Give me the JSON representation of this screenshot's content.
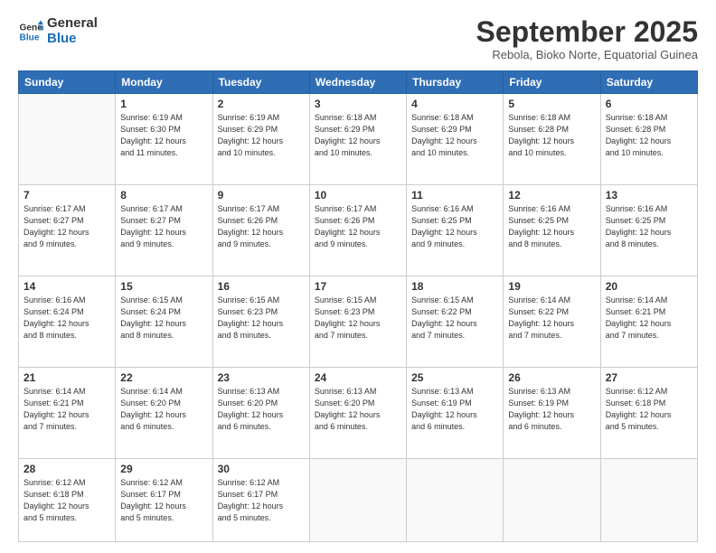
{
  "logo": {
    "line1": "General",
    "line2": "Blue"
  },
  "title": "September 2025",
  "location": "Rebola, Bioko Norte, Equatorial Guinea",
  "header_days": [
    "Sunday",
    "Monday",
    "Tuesday",
    "Wednesday",
    "Thursday",
    "Friday",
    "Saturday"
  ],
  "weeks": [
    [
      {
        "day": "",
        "info": ""
      },
      {
        "day": "1",
        "info": "Sunrise: 6:19 AM\nSunset: 6:30 PM\nDaylight: 12 hours\nand 11 minutes."
      },
      {
        "day": "2",
        "info": "Sunrise: 6:19 AM\nSunset: 6:29 PM\nDaylight: 12 hours\nand 10 minutes."
      },
      {
        "day": "3",
        "info": "Sunrise: 6:18 AM\nSunset: 6:29 PM\nDaylight: 12 hours\nand 10 minutes."
      },
      {
        "day": "4",
        "info": "Sunrise: 6:18 AM\nSunset: 6:29 PM\nDaylight: 12 hours\nand 10 minutes."
      },
      {
        "day": "5",
        "info": "Sunrise: 6:18 AM\nSunset: 6:28 PM\nDaylight: 12 hours\nand 10 minutes."
      },
      {
        "day": "6",
        "info": "Sunrise: 6:18 AM\nSunset: 6:28 PM\nDaylight: 12 hours\nand 10 minutes."
      }
    ],
    [
      {
        "day": "7",
        "info": "Sunrise: 6:17 AM\nSunset: 6:27 PM\nDaylight: 12 hours\nand 9 minutes."
      },
      {
        "day": "8",
        "info": "Sunrise: 6:17 AM\nSunset: 6:27 PM\nDaylight: 12 hours\nand 9 minutes."
      },
      {
        "day": "9",
        "info": "Sunrise: 6:17 AM\nSunset: 6:26 PM\nDaylight: 12 hours\nand 9 minutes."
      },
      {
        "day": "10",
        "info": "Sunrise: 6:17 AM\nSunset: 6:26 PM\nDaylight: 12 hours\nand 9 minutes."
      },
      {
        "day": "11",
        "info": "Sunrise: 6:16 AM\nSunset: 6:25 PM\nDaylight: 12 hours\nand 9 minutes."
      },
      {
        "day": "12",
        "info": "Sunrise: 6:16 AM\nSunset: 6:25 PM\nDaylight: 12 hours\nand 8 minutes."
      },
      {
        "day": "13",
        "info": "Sunrise: 6:16 AM\nSunset: 6:25 PM\nDaylight: 12 hours\nand 8 minutes."
      }
    ],
    [
      {
        "day": "14",
        "info": "Sunrise: 6:16 AM\nSunset: 6:24 PM\nDaylight: 12 hours\nand 8 minutes."
      },
      {
        "day": "15",
        "info": "Sunrise: 6:15 AM\nSunset: 6:24 PM\nDaylight: 12 hours\nand 8 minutes."
      },
      {
        "day": "16",
        "info": "Sunrise: 6:15 AM\nSunset: 6:23 PM\nDaylight: 12 hours\nand 8 minutes."
      },
      {
        "day": "17",
        "info": "Sunrise: 6:15 AM\nSunset: 6:23 PM\nDaylight: 12 hours\nand 7 minutes."
      },
      {
        "day": "18",
        "info": "Sunrise: 6:15 AM\nSunset: 6:22 PM\nDaylight: 12 hours\nand 7 minutes."
      },
      {
        "day": "19",
        "info": "Sunrise: 6:14 AM\nSunset: 6:22 PM\nDaylight: 12 hours\nand 7 minutes."
      },
      {
        "day": "20",
        "info": "Sunrise: 6:14 AM\nSunset: 6:21 PM\nDaylight: 12 hours\nand 7 minutes."
      }
    ],
    [
      {
        "day": "21",
        "info": "Sunrise: 6:14 AM\nSunset: 6:21 PM\nDaylight: 12 hours\nand 7 minutes."
      },
      {
        "day": "22",
        "info": "Sunrise: 6:14 AM\nSunset: 6:20 PM\nDaylight: 12 hours\nand 6 minutes."
      },
      {
        "day": "23",
        "info": "Sunrise: 6:13 AM\nSunset: 6:20 PM\nDaylight: 12 hours\nand 6 minutes."
      },
      {
        "day": "24",
        "info": "Sunrise: 6:13 AM\nSunset: 6:20 PM\nDaylight: 12 hours\nand 6 minutes."
      },
      {
        "day": "25",
        "info": "Sunrise: 6:13 AM\nSunset: 6:19 PM\nDaylight: 12 hours\nand 6 minutes."
      },
      {
        "day": "26",
        "info": "Sunrise: 6:13 AM\nSunset: 6:19 PM\nDaylight: 12 hours\nand 6 minutes."
      },
      {
        "day": "27",
        "info": "Sunrise: 6:12 AM\nSunset: 6:18 PM\nDaylight: 12 hours\nand 5 minutes."
      }
    ],
    [
      {
        "day": "28",
        "info": "Sunrise: 6:12 AM\nSunset: 6:18 PM\nDaylight: 12 hours\nand 5 minutes."
      },
      {
        "day": "29",
        "info": "Sunrise: 6:12 AM\nSunset: 6:17 PM\nDaylight: 12 hours\nand 5 minutes."
      },
      {
        "day": "30",
        "info": "Sunrise: 6:12 AM\nSunset: 6:17 PM\nDaylight: 12 hours\nand 5 minutes."
      },
      {
        "day": "",
        "info": ""
      },
      {
        "day": "",
        "info": ""
      },
      {
        "day": "",
        "info": ""
      },
      {
        "day": "",
        "info": ""
      }
    ]
  ]
}
